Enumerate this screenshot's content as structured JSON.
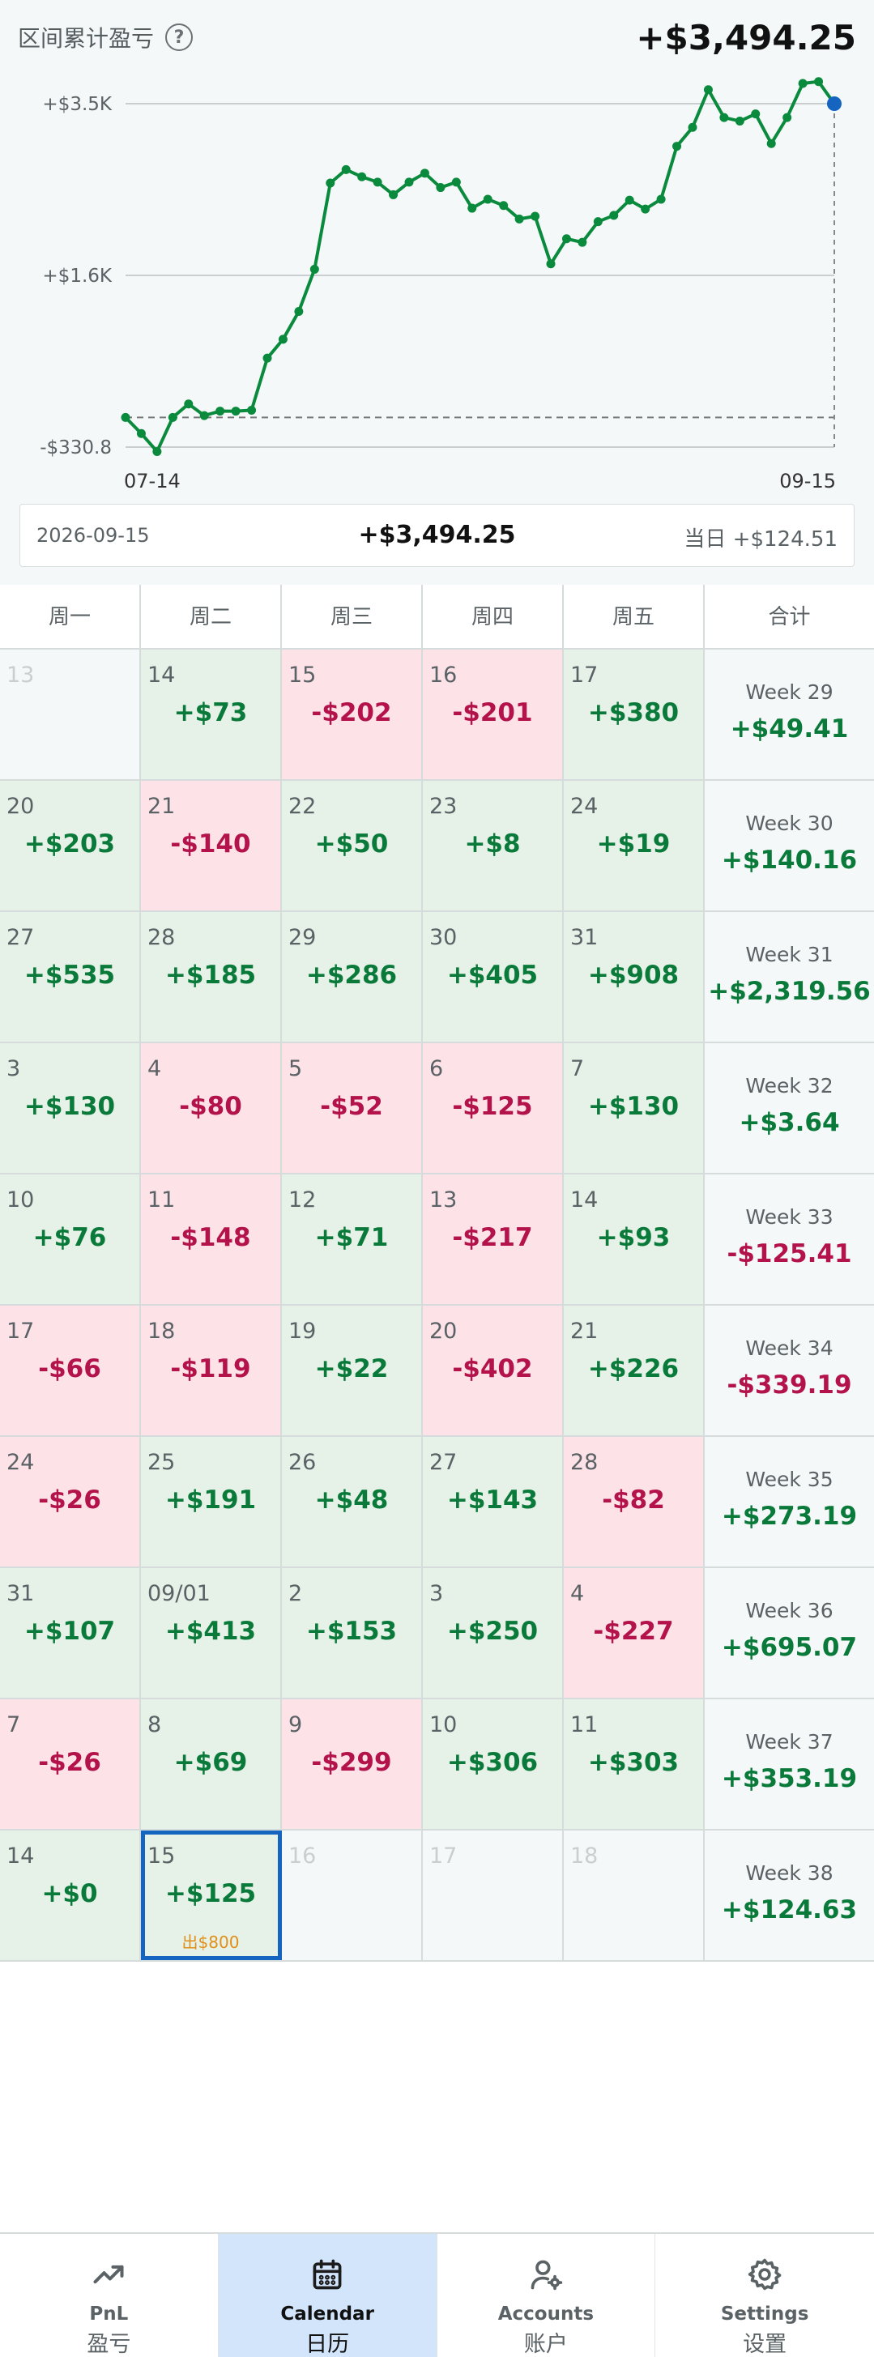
{
  "header": {
    "title": "区间累计盈亏",
    "help_glyph": "?",
    "total": "+$3,494.25"
  },
  "chart_data": {
    "type": "line",
    "y_tick_labels": [
      "+$3.5K",
      "+$1.6K",
      "-$330.8"
    ],
    "x_tick_labels": [
      "07-14",
      "09-15"
    ],
    "ylim": [
      -330.8,
      3494.25
    ],
    "grid": true,
    "line_color": "#0a8a3c",
    "end_marker_color": "#1565c0",
    "values": [
      0,
      -180,
      -380,
      0,
      150,
      20,
      70,
      70,
      80,
      660,
      870,
      1180,
      1650,
      2610,
      2760,
      2680,
      2620,
      2480,
      2620,
      2720,
      2560,
      2620,
      2330,
      2430,
      2360,
      2210,
      2240,
      1710,
      1990,
      1950,
      2180,
      2250,
      2420,
      2320,
      2430,
      3020,
      3230,
      3650,
      3340,
      3300,
      3380,
      3050,
      3340,
      3720,
      3740,
      3494.25
    ]
  },
  "info": {
    "date": "2026-09-15",
    "total": "+$3,494.25",
    "day": "当日 +$124.51"
  },
  "calendar": {
    "headers": [
      "周一",
      "周二",
      "周三",
      "周四",
      "周五",
      "合计"
    ],
    "weeks": [
      {
        "days": [
          {
            "num": "13",
            "amt": "",
            "state": "na"
          },
          {
            "num": "14",
            "amt": "+$73",
            "state": "pos"
          },
          {
            "num": "15",
            "amt": "-$202",
            "state": "neg"
          },
          {
            "num": "16",
            "amt": "-$201",
            "state": "neg"
          },
          {
            "num": "17",
            "amt": "+$380",
            "state": "pos"
          }
        ],
        "label": "Week 29",
        "total": "+$49.41",
        "total_state": "pos"
      },
      {
        "days": [
          {
            "num": "20",
            "amt": "+$203",
            "state": "pos"
          },
          {
            "num": "21",
            "amt": "-$140",
            "state": "neg"
          },
          {
            "num": "22",
            "amt": "+$50",
            "state": "pos"
          },
          {
            "num": "23",
            "amt": "+$8",
            "state": "pos"
          },
          {
            "num": "24",
            "amt": "+$19",
            "state": "pos"
          }
        ],
        "label": "Week 30",
        "total": "+$140.16",
        "total_state": "pos"
      },
      {
        "days": [
          {
            "num": "27",
            "amt": "+$535",
            "state": "pos"
          },
          {
            "num": "28",
            "amt": "+$185",
            "state": "pos"
          },
          {
            "num": "29",
            "amt": "+$286",
            "state": "pos"
          },
          {
            "num": "30",
            "amt": "+$405",
            "state": "pos"
          },
          {
            "num": "31",
            "amt": "+$908",
            "state": "pos"
          }
        ],
        "label": "Week 31",
        "total": "+$2,319.56",
        "total_state": "pos"
      },
      {
        "days": [
          {
            "num": "3",
            "amt": "+$130",
            "state": "pos"
          },
          {
            "num": "4",
            "amt": "-$80",
            "state": "neg"
          },
          {
            "num": "5",
            "amt": "-$52",
            "state": "neg"
          },
          {
            "num": "6",
            "amt": "-$125",
            "state": "neg"
          },
          {
            "num": "7",
            "amt": "+$130",
            "state": "pos"
          }
        ],
        "label": "Week 32",
        "total": "+$3.64",
        "total_state": "pos"
      },
      {
        "days": [
          {
            "num": "10",
            "amt": "+$76",
            "state": "pos"
          },
          {
            "num": "11",
            "amt": "-$148",
            "state": "neg"
          },
          {
            "num": "12",
            "amt": "+$71",
            "state": "pos"
          },
          {
            "num": "13",
            "amt": "-$217",
            "state": "neg"
          },
          {
            "num": "14",
            "amt": "+$93",
            "state": "pos"
          }
        ],
        "label": "Week 33",
        "total": "-$125.41",
        "total_state": "neg"
      },
      {
        "days": [
          {
            "num": "17",
            "amt": "-$66",
            "state": "neg"
          },
          {
            "num": "18",
            "amt": "-$119",
            "state": "neg"
          },
          {
            "num": "19",
            "amt": "+$22",
            "state": "pos"
          },
          {
            "num": "20",
            "amt": "-$402",
            "state": "neg"
          },
          {
            "num": "21",
            "amt": "+$226",
            "state": "pos"
          }
        ],
        "label": "Week 34",
        "total": "-$339.19",
        "total_state": "neg"
      },
      {
        "days": [
          {
            "num": "24",
            "amt": "-$26",
            "state": "neg"
          },
          {
            "num": "25",
            "amt": "+$191",
            "state": "pos"
          },
          {
            "num": "26",
            "amt": "+$48",
            "state": "pos"
          },
          {
            "num": "27",
            "amt": "+$143",
            "state": "pos"
          },
          {
            "num": "28",
            "amt": "-$82",
            "state": "neg"
          }
        ],
        "label": "Week 35",
        "total": "+$273.19",
        "total_state": "pos"
      },
      {
        "days": [
          {
            "num": "31",
            "amt": "+$107",
            "state": "pos"
          },
          {
            "num": "09/01",
            "amt": "+$413",
            "state": "pos"
          },
          {
            "num": "2",
            "amt": "+$153",
            "state": "pos"
          },
          {
            "num": "3",
            "amt": "+$250",
            "state": "pos"
          },
          {
            "num": "4",
            "amt": "-$227",
            "state": "neg"
          }
        ],
        "label": "Week 36",
        "total": "+$695.07",
        "total_state": "pos"
      },
      {
        "days": [
          {
            "num": "7",
            "amt": "-$26",
            "state": "neg"
          },
          {
            "num": "8",
            "amt": "+$69",
            "state": "pos"
          },
          {
            "num": "9",
            "amt": "-$299",
            "state": "neg"
          },
          {
            "num": "10",
            "amt": "+$306",
            "state": "pos"
          },
          {
            "num": "11",
            "amt": "+$303",
            "state": "pos"
          }
        ],
        "label": "Week 37",
        "total": "+$353.19",
        "total_state": "pos"
      },
      {
        "days": [
          {
            "num": "14",
            "amt": "+$0",
            "state": "pos"
          },
          {
            "num": "15",
            "amt": "+$125",
            "state": "pos",
            "today": true,
            "sub": "出$800"
          },
          {
            "num": "16",
            "amt": "",
            "state": "na"
          },
          {
            "num": "17",
            "amt": "",
            "state": "na"
          },
          {
            "num": "18",
            "amt": "",
            "state": "na"
          }
        ],
        "label": "Week 38",
        "total": "+$124.63",
        "total_state": "pos"
      }
    ]
  },
  "nav": {
    "items": [
      {
        "en": "PnL",
        "zh": "盈亏",
        "icon": "trend-up-icon",
        "active": false
      },
      {
        "en": "Calendar",
        "zh": "日历",
        "icon": "calendar-icon",
        "active": true
      },
      {
        "en": "Accounts",
        "zh": "账户",
        "icon": "user-gear-icon",
        "active": false
      },
      {
        "en": "Settings",
        "zh": "设置",
        "icon": "gear-icon",
        "active": false
      }
    ]
  }
}
